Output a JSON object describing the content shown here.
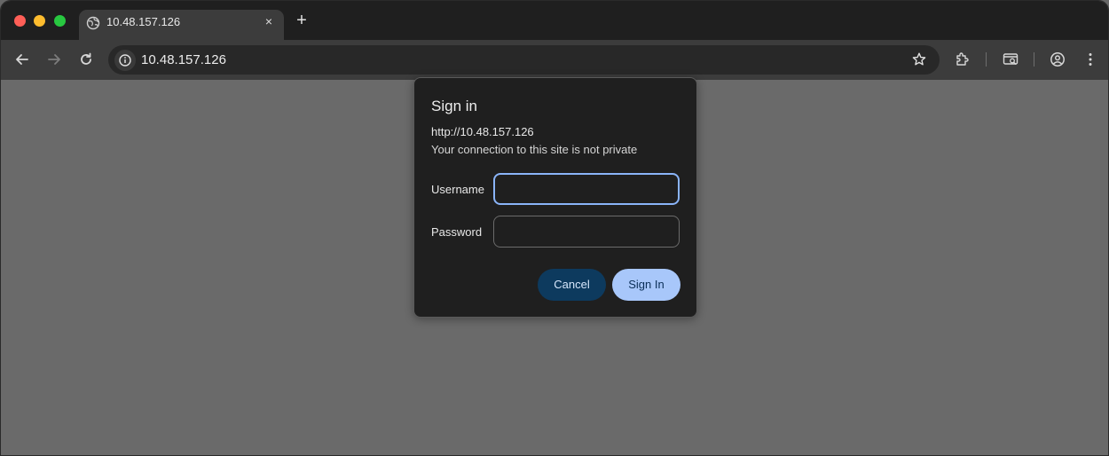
{
  "browser": {
    "tab": {
      "title": "10.48.157.126",
      "close_label": "×"
    },
    "new_tab_label": "+",
    "address_bar": {
      "url": "10.48.157.126"
    }
  },
  "dialog": {
    "title": "Sign in",
    "origin": "http://10.48.157.126",
    "warning": "Your connection to this site is not private",
    "username_label": "Username",
    "username_value": "",
    "password_label": "Password",
    "password_value": "",
    "cancel_label": "Cancel",
    "signin_label": "Sign In"
  },
  "colors": {
    "accent": "#8ab4f8",
    "signin_button": "#a8c7fa",
    "cancel_button": "#0d3a5e",
    "page_background": "#676767"
  }
}
